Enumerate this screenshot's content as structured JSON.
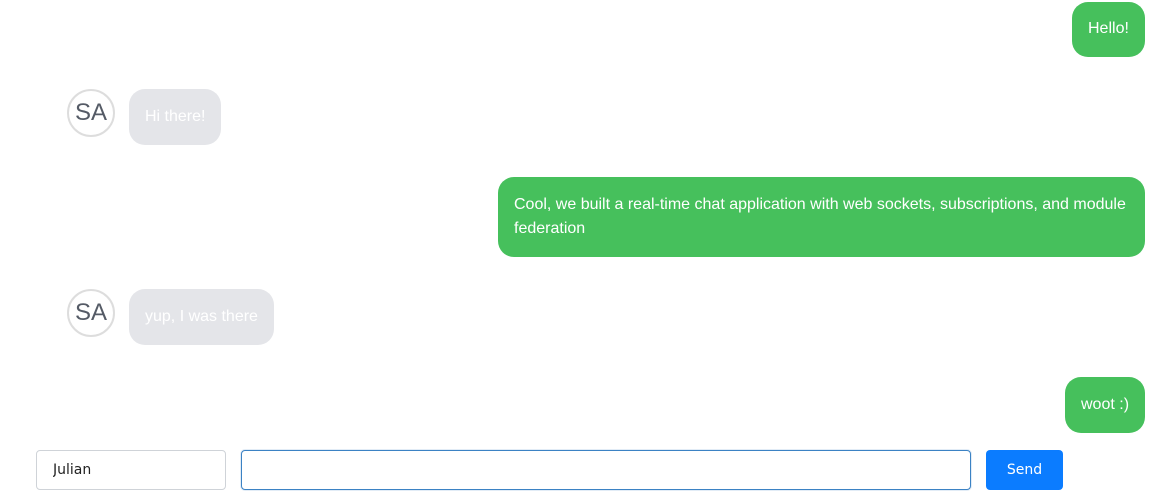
{
  "messages": [
    {
      "from": "self",
      "text": "Hello!"
    },
    {
      "from": "other",
      "avatar": "SA",
      "text": "Hi there!"
    },
    {
      "from": "self",
      "text": "Cool, we built a real-time chat application with web sockets, subscriptions, and module federation"
    },
    {
      "from": "other",
      "avatar": "SA",
      "text": "yup, I was there"
    },
    {
      "from": "self",
      "text": "woot :)"
    }
  ],
  "composer": {
    "name_value": "Julian",
    "message_value": "",
    "send_label": "Send"
  },
  "colors": {
    "sent_bubble": "#46c05c",
    "received_bubble": "#e4e5e9",
    "send_button": "#0b7cff",
    "focus_border": "#3b82c4"
  }
}
